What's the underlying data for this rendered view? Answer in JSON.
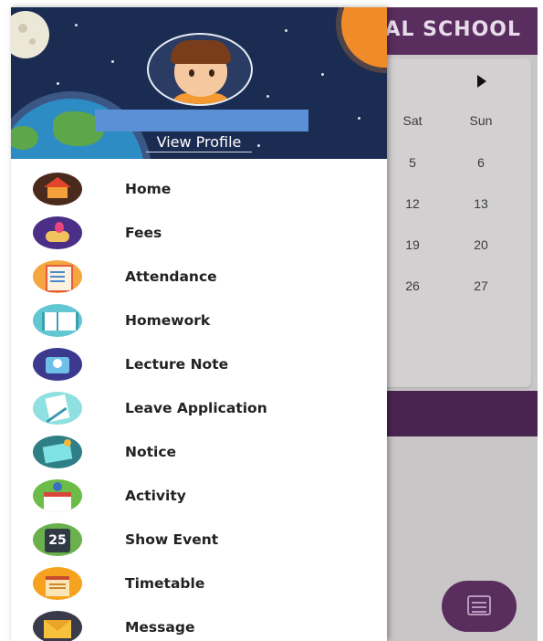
{
  "app": {
    "title_visible": "AL SCHOOL",
    "calendar": {
      "weekday_headers": [
        "Sat",
        "Sun"
      ],
      "rows": [
        [
          "5",
          "6"
        ],
        [
          "12",
          "13"
        ],
        [
          "19",
          "20"
        ],
        [
          "26",
          "27"
        ]
      ]
    }
  },
  "drawer": {
    "profile": {
      "name": "",
      "view_profile_label": "View Profile"
    },
    "menu": [
      {
        "label": "Home",
        "icon": "home-icon"
      },
      {
        "label": "Fees",
        "icon": "fees-icon"
      },
      {
        "label": "Attendance",
        "icon": "attendance-icon"
      },
      {
        "label": "Homework",
        "icon": "homework-icon"
      },
      {
        "label": "Lecture Note",
        "icon": "lecture-note-icon"
      },
      {
        "label": "Leave Application",
        "icon": "leave-application-icon"
      },
      {
        "label": "Notice",
        "icon": "notice-icon"
      },
      {
        "label": "Activity",
        "icon": "activity-icon"
      },
      {
        "label": "Show Event",
        "icon": "show-event-icon",
        "icon_text": "25"
      },
      {
        "label": "Timetable",
        "icon": "timetable-icon"
      },
      {
        "label": "Message",
        "icon": "message-icon"
      }
    ]
  },
  "colors": {
    "header_purple": "#5a2d5f",
    "drawer_header_bg": "#1b2c52",
    "name_redaction": "#5b8fd6"
  }
}
